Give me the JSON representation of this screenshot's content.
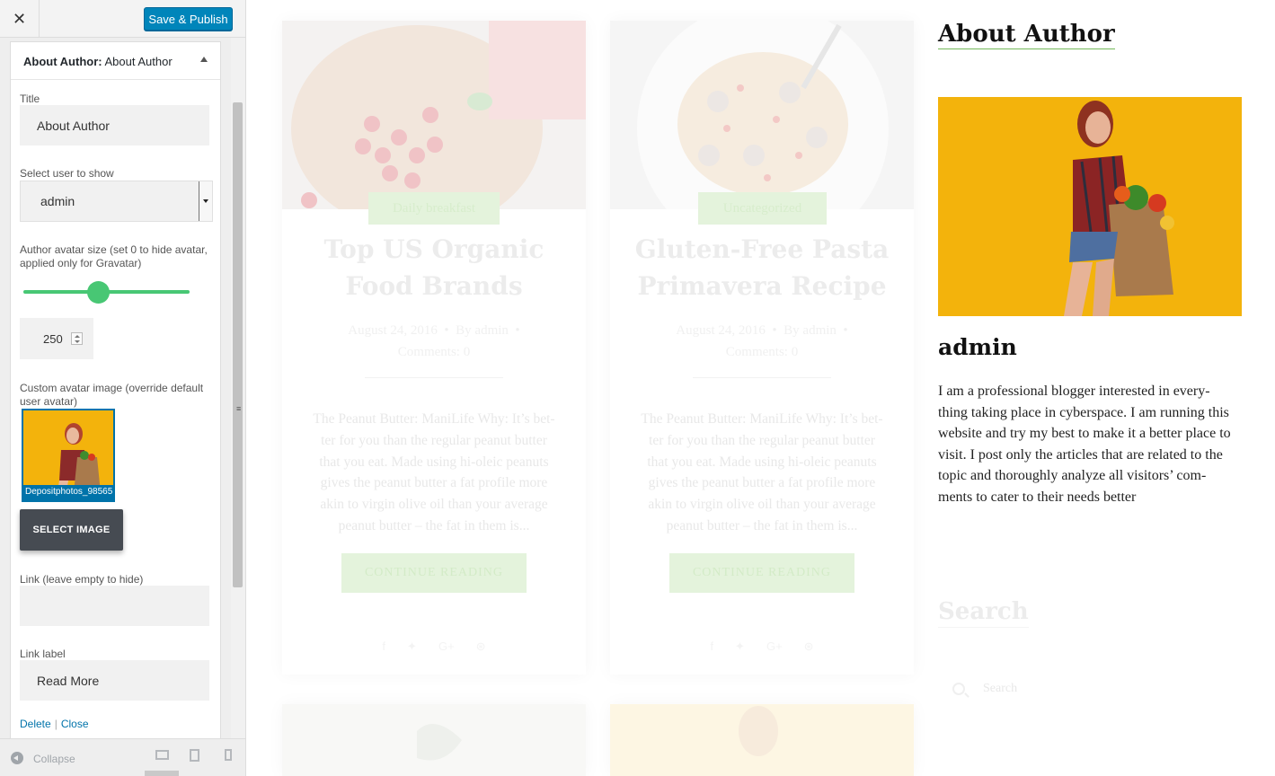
{
  "customizer": {
    "close_glyph": "✕",
    "publish_label": "Save & Publish",
    "widget": {
      "type_label": "About Author:",
      "instance_label": "About Author",
      "fields": {
        "title_label": "Title",
        "title_value": "About Author",
        "user_label": "Select user to show",
        "user_value": "admin",
        "avatar_size_label": "Author avatar size (set 0 to hide avatar, applied only for Gravatar)",
        "avatar_size_fraction": 0.45,
        "avatar_size_value": "250",
        "custom_avatar_label": "Custom avatar image (override default user avatar)",
        "custom_avatar_filename": "Depositphotos_98565",
        "select_image_label": "SELECT IMAGE",
        "link_label": "Link (leave empty to hide)",
        "link_value": "",
        "link_text_label": "Link label",
        "link_text_value": "Read More"
      },
      "actions": {
        "delete": "Delete",
        "separator": "|",
        "close": "Close"
      }
    },
    "footer": {
      "collapse_label": "Collapse"
    }
  },
  "preview": {
    "posts": [
      {
        "category": "Daily breakfast",
        "title_line1": "Top US Organic",
        "title_line2": "Food Brands",
        "date": "August 24, 2016",
        "by": "By",
        "author": "admin",
        "comments_label": "Comments:",
        "comments_count": "0",
        "excerpt_lines": [
          "The Peanut Butter: ManiLife Why: It’s bet-",
          "ter for you than the regular peanut butter",
          "that you eat. Made using hi-oleic peanuts",
          "gives the peanut butter a fat profile more",
          "akin to virgin olive oil than your average",
          "peanut butter – the fat in them is..."
        ],
        "button": "CONTINUE READING"
      },
      {
        "category": "Uncategorized",
        "title_line1": "Gluten-Free Pasta",
        "title_line2": "Primavera Recipe",
        "date": "August 24, 2016",
        "by": "By",
        "author": "admin",
        "comments_label": "Comments:",
        "comments_count": "0",
        "excerpt_lines": [
          "The Peanut Butter: ManiLife Why: It’s bet-",
          "ter for you than the regular peanut butter",
          "that you eat. Made using hi-oleic peanuts",
          "gives the peanut butter a fat profile more",
          "akin to virgin olive oil than your average",
          "peanut butter – the fat in them is..."
        ],
        "button": "CONTINUE READING"
      }
    ],
    "about_widget": {
      "title": "About Author",
      "name": "admin",
      "bio_lines": [
        "I am a professional blogger interested in every-",
        "thing taking place in cyberspace. I am running this",
        "website and try my best to make it a better place to",
        "visit. I post only the articles that are related to the",
        "topic and thoroughly analyze all visitors’ com-",
        "ments to cater to their needs better"
      ]
    },
    "search_widget": {
      "title": "Search",
      "placeholder": "Search"
    }
  },
  "colors": {
    "primary_button": "#0085ba",
    "accent_green": "#48c774",
    "photo_background": "#f3b30c"
  }
}
